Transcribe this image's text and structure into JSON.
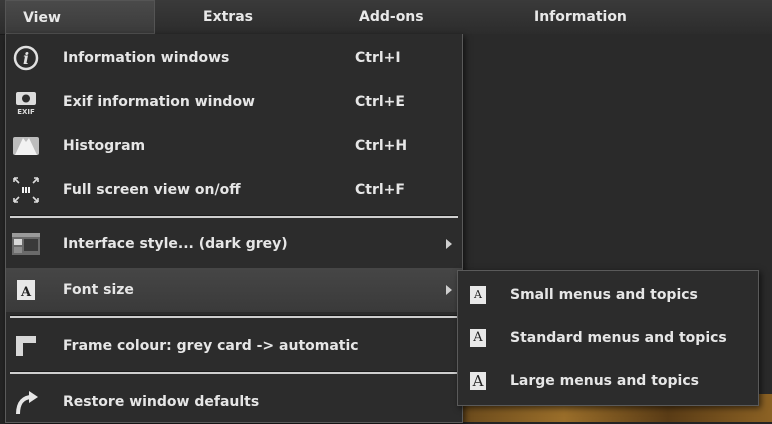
{
  "menubar": {
    "items": [
      "View",
      "Extras",
      "Add-ons",
      "Information"
    ]
  },
  "view_menu": {
    "items": [
      {
        "label": "Information windows",
        "shortcut": "Ctrl+I",
        "icon": "info-icon"
      },
      {
        "label": "Exif information window",
        "shortcut": "Ctrl+E",
        "icon": "exif-camera-icon"
      },
      {
        "label": "Histogram",
        "shortcut": "Ctrl+H",
        "icon": "histogram-icon"
      },
      {
        "label": "Full screen view on/off",
        "shortcut": "Ctrl+F",
        "icon": "fullscreen-icon"
      },
      {
        "label": "Interface style... (dark grey)",
        "icon": "interface-style-icon"
      },
      {
        "label": "Font size",
        "icon": "font-icon"
      },
      {
        "label": "Frame colour: grey card -> automatic",
        "icon": "frame-icon"
      },
      {
        "label": "Restore window defaults",
        "icon": "restore-arrow-icon"
      }
    ]
  },
  "font_size_submenu": {
    "items": [
      {
        "label": "Small menus and topics",
        "glyph": "A"
      },
      {
        "label": "Standard menus and topics",
        "glyph": "A"
      },
      {
        "label": "Large menus and topics",
        "glyph": "A"
      }
    ]
  }
}
